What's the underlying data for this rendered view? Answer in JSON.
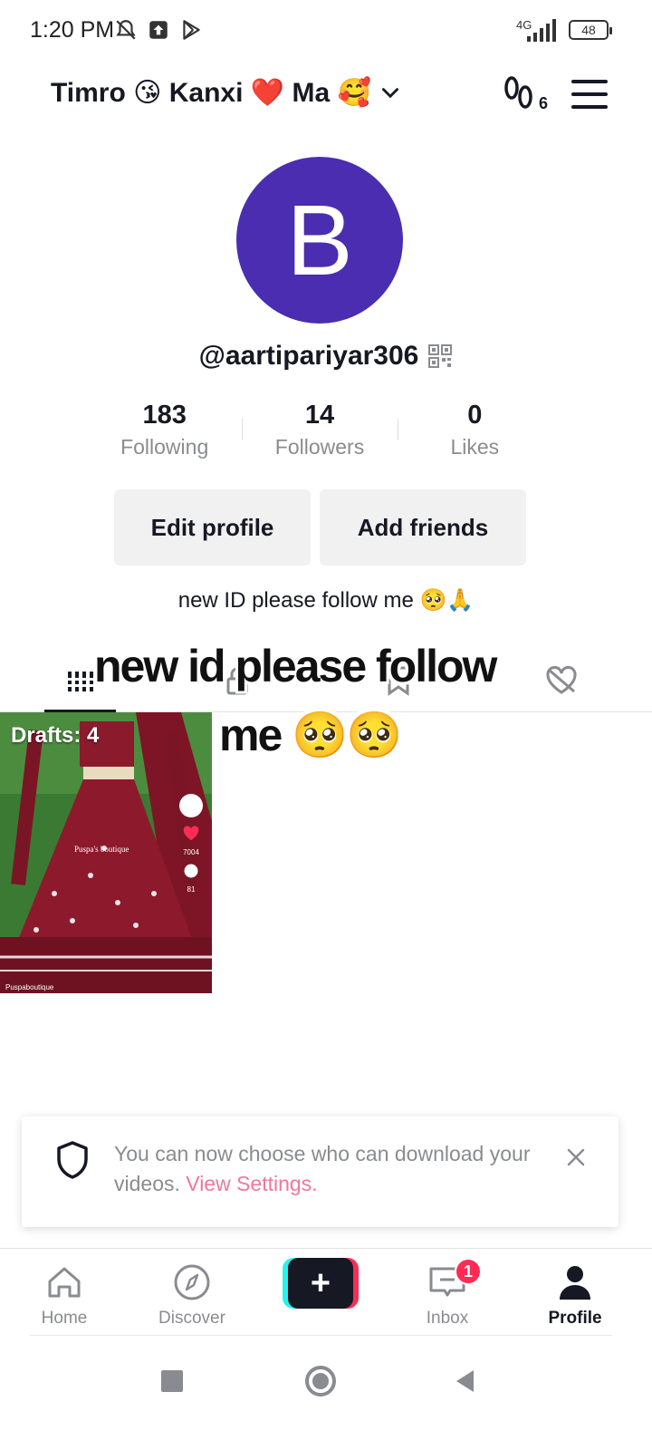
{
  "status_bar": {
    "time": "1:20 PM",
    "network": "4G",
    "battery": "48"
  },
  "header": {
    "account_name": "Timro 😘 Kanxi ❤️ Ma 🥰",
    "visitors_count": "6"
  },
  "profile": {
    "avatar_letter": "B",
    "avatar_color": "#4a2db0",
    "username": "@aartipariyar306",
    "stats": [
      {
        "value": "183",
        "label": "Following"
      },
      {
        "value": "14",
        "label": "Followers"
      },
      {
        "value": "0",
        "label": "Likes"
      }
    ],
    "edit_profile_label": "Edit profile",
    "add_friends_label": "Add friends",
    "bio": "new ID please follow me 🥺🙏"
  },
  "overlay_caption": {
    "line1": "new id please follow",
    "line2": "me 🥺🥺"
  },
  "draft": {
    "label": "Drafts: 4",
    "brand_text": "Puspa's boutique",
    "likes": "7004",
    "comments": "81",
    "footer_text": "Puspaboutique"
  },
  "toast": {
    "message": "You can now choose who can download your videos.",
    "link_label": "View Settings."
  },
  "bottom_nav": {
    "home": "Home",
    "discover": "Discover",
    "inbox": "Inbox",
    "inbox_badge": "1",
    "profile": "Profile"
  },
  "colors": {
    "accent_pink": "#fe2c55",
    "accent_cyan": "#25f4ee",
    "link_pink": "#f0779b"
  }
}
